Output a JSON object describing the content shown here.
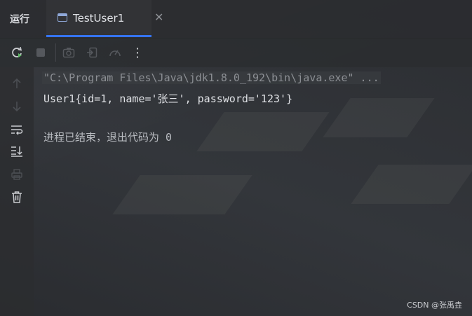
{
  "tool_window": {
    "title": "运行",
    "tab": {
      "label": "TestUser1",
      "icon": "console-window-icon",
      "close_glyph": "✕"
    }
  },
  "toolbar": {
    "buttons": [
      {
        "name": "rerun-icon"
      },
      {
        "name": "stop-icon"
      },
      {
        "name": "screenshot-icon"
      },
      {
        "name": "restore-layout-icon"
      },
      {
        "name": "profiler-icon"
      },
      {
        "name": "more-options-icon",
        "glyph": "⋮"
      }
    ]
  },
  "sidebar": {
    "buttons": [
      {
        "name": "arrow-up-icon"
      },
      {
        "name": "arrow-down-icon"
      },
      {
        "name": "soft-wrap-icon"
      },
      {
        "name": "scroll-to-end-icon"
      },
      {
        "name": "print-icon"
      },
      {
        "name": "trash-icon"
      }
    ]
  },
  "console": {
    "command_line": "\"C:\\Program Files\\Java\\jdk1.8.0_192\\bin\\java.exe\" ...",
    "output_line": "User1{id=1, name='张三', password='123'}",
    "exit_line": "进程已结束，退出代码为 0"
  },
  "watermark": "CSDN @张禹垚",
  "colors": {
    "accent": "#3574f0",
    "rerun_green": "#5fb865",
    "text": "#dfe1e5"
  }
}
